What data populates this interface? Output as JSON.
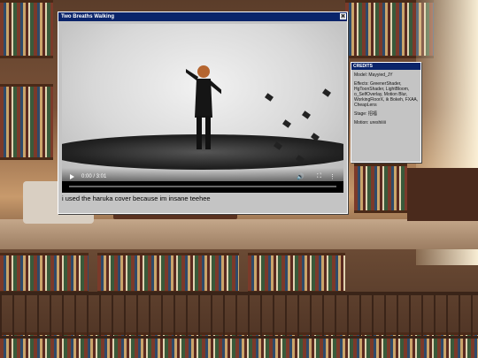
{
  "video_window": {
    "title": "Two Breaths Walking",
    "close_glyph": "✕",
    "player": {
      "time": "0:00 / 3:01",
      "icons": [
        "play-icon",
        "volume-icon",
        "fullscreen-icon",
        "more-icon"
      ],
      "volume_glyph": "🔊",
      "fullscreen_glyph": "⛶",
      "more_glyph": "⋮"
    },
    "caption": "i used the haruka cover because im insane teehee"
  },
  "credits_window": {
    "title": "CREDITS",
    "model": "Model: Mayyied_JY",
    "effects": "Effects: GreenerShader, HgToonShader, LightBloom, o_SelfOverlay, Motion Blur, WorkingFloorX, ik Bokeh, FXAA, CheapLens",
    "stage": "Stage: 招福",
    "motion": "Motion: ureshiiiii"
  },
  "colors": {
    "titlebar": "#0a246a",
    "window_face": "#c4c4c4"
  }
}
